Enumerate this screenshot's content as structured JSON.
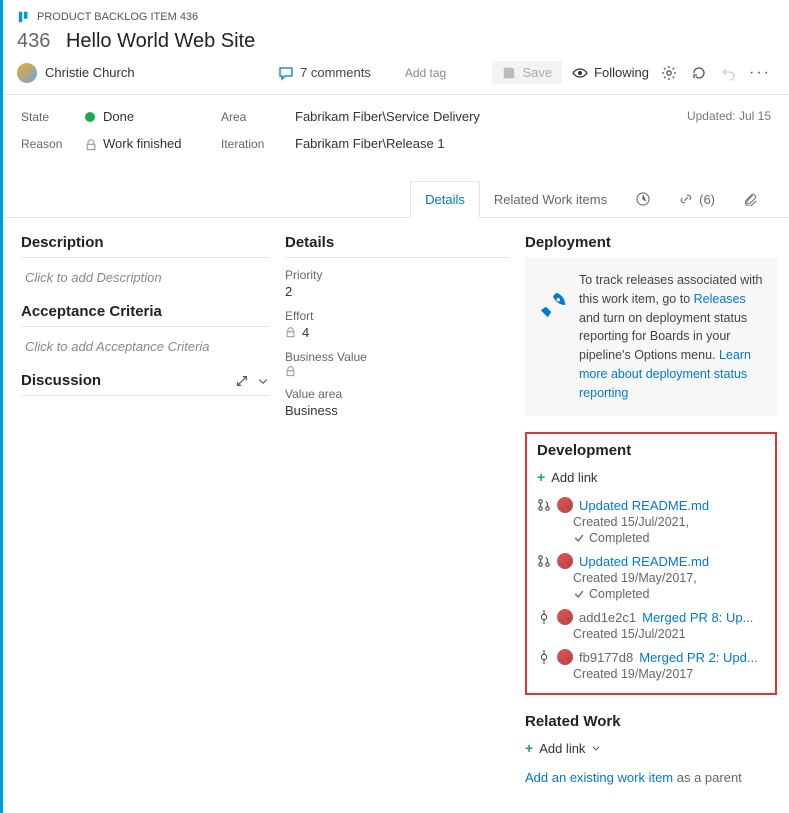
{
  "breadcrumb": {
    "type_label": "PRODUCT BACKLOG ITEM 436"
  },
  "item": {
    "id": "436",
    "title": "Hello World Web Site"
  },
  "assignee": {
    "name": "Christie Church"
  },
  "comments": {
    "count_label": "7 comments"
  },
  "add_tag": "Add tag",
  "toolbar": {
    "save": "Save",
    "following": "Following"
  },
  "fields": {
    "state_label": "State",
    "state_value": "Done",
    "reason_label": "Reason",
    "reason_value": "Work finished",
    "area_label": "Area",
    "area_value": "Fabrikam Fiber\\Service Delivery",
    "iteration_label": "Iteration",
    "iteration_value": "Fabrikam Fiber\\Release 1",
    "updated": "Updated: Jul 15"
  },
  "tabs": {
    "details": "Details",
    "related": "Related Work items",
    "attach_count": "(6)"
  },
  "left": {
    "description_h": "Description",
    "description_ph": "Click to add Description",
    "acceptance_h": "Acceptance Criteria",
    "acceptance_ph": "Click to add Acceptance Criteria",
    "discussion_h": "Discussion"
  },
  "details": {
    "heading": "Details",
    "priority_label": "Priority",
    "priority_value": "2",
    "effort_label": "Effort",
    "effort_value": "4",
    "bv_label": "Business Value",
    "va_label": "Value area",
    "va_value": "Business"
  },
  "deployment": {
    "heading": "Deployment",
    "text1": "To track releases associated with this work item, go to ",
    "link1": "Releases",
    "text2": " and turn on deployment status reporting for Boards in your pipeline's Options menu. ",
    "link2": "Learn more about deployment status reporting"
  },
  "development": {
    "heading": "Development",
    "add_link": "Add link",
    "items": [
      {
        "type": "pr",
        "title": "Updated README.md",
        "created": "Created 15/Jul/2021,",
        "status": "Completed"
      },
      {
        "type": "pr",
        "title": "Updated README.md",
        "created": "Created 19/May/2017,",
        "status": "Completed"
      },
      {
        "type": "commit",
        "hash": "add1e2c1",
        "title": "Merged PR 8: Up...",
        "created": "Created 15/Jul/2021"
      },
      {
        "type": "commit",
        "hash": "fb9177d8",
        "title": "Merged PR 2: Upd...",
        "created": "Created 19/May/2017"
      }
    ]
  },
  "related": {
    "heading": "Related Work",
    "add_link": "Add link",
    "add_parent_link": "Add an existing work item",
    "add_parent_suffix": " as a parent"
  }
}
